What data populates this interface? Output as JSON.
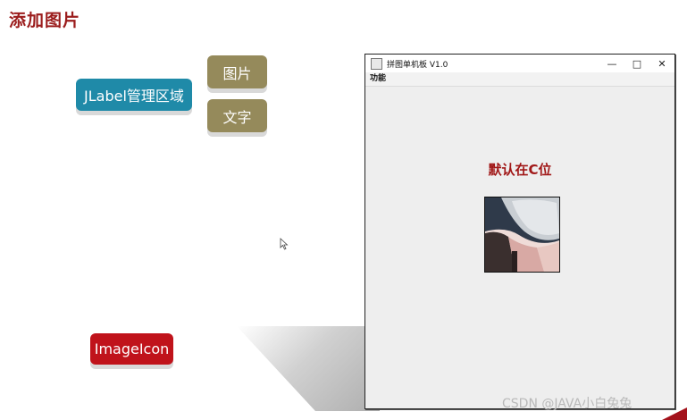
{
  "slide": {
    "title": "添加图片",
    "pill_jlabel": "JLabel管理区域",
    "pill_image": "图片",
    "pill_text": "文字",
    "pill_imageicon": "ImageIcon",
    "watermark": "CSDN @JAVA小白兔兔"
  },
  "window": {
    "title": "拼图单机板 V1.0",
    "menu": [
      "功能"
    ],
    "main_label": "默认在C位",
    "controls": {
      "minimize": "—",
      "maximize": "□",
      "close": "✕"
    }
  },
  "colors": {
    "title_red": "#9b1c1c",
    "jlabel_teal": "#1f8aa8",
    "olive": "#958a5b",
    "imageicon_red": "#c0131b"
  }
}
